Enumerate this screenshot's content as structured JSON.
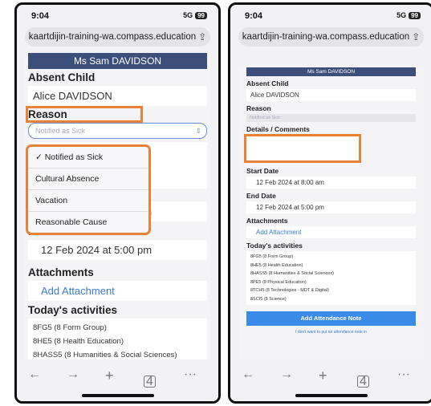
{
  "status": {
    "time": "9:04",
    "signal": "5G",
    "battery": "99"
  },
  "browser": {
    "url": "kaartdijin-training-wa.compass.education"
  },
  "student_header": "Ms Sam DAVIDSON",
  "form": {
    "absent_child_label": "Absent Child",
    "absent_child_value": "Alice DAVIDSON",
    "reason_label": "Reason",
    "reason_placeholder": "Notified as Sick",
    "reason_options": [
      "✓ Notified as Sick",
      "Cultural Absence",
      "Vacation",
      "Reasonable Cause"
    ],
    "details_label": "Details / Comments",
    "start_date_label": "Start Date",
    "start_date_value": "12 Feb 2024 at 8:00 am",
    "start_date_value_obscured": "12 Feb 2024 at 8:00 am",
    "end_date_label": "End Date",
    "end_date_value": "12 Feb 2024 at 5:00 pm",
    "attachments_label": "Attachments",
    "add_attachment": "Add Attachment",
    "activities_label": "Today's activities",
    "activities": [
      "8FG5 (8 Form Group)",
      "8HE5 (8 Health Education)",
      "8HASS5 (8 Humanities & Social Sciences)",
      "8PE5 (8 Physical Education)",
      "8TCH5 (8 Technologies - MDT & Digital)",
      "8SCI5 (8 Science)"
    ],
    "add_note_button": "Add Attendance Note",
    "no_note_link": "I don't want to put an attendance note in"
  },
  "toolbar": {
    "back": "←",
    "forward": "→",
    "new_tab": "+",
    "tabs": "4",
    "more": "···"
  },
  "colors": {
    "header": "#3c4f7a",
    "highlight": "#e8823a",
    "link": "#3a7bd5",
    "button": "#3a8be8"
  }
}
